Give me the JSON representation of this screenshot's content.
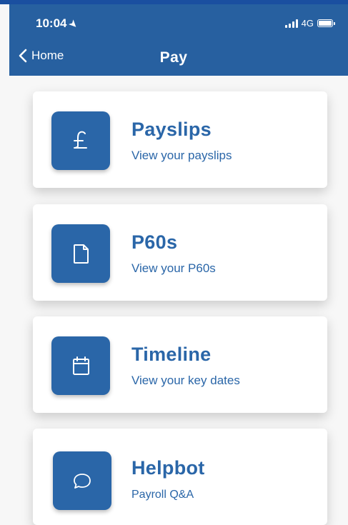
{
  "status_bar": {
    "time": "10:04",
    "network": "4G"
  },
  "nav": {
    "back_label": "Home",
    "title": "Pay"
  },
  "cards": [
    {
      "title": "Payslips",
      "subtitle": "View your payslips",
      "icon": "pound-icon"
    },
    {
      "title": "P60s",
      "subtitle": "View your P60s",
      "icon": "document-icon"
    },
    {
      "title": "Timeline",
      "subtitle": "View your key dates",
      "icon": "calendar-icon"
    },
    {
      "title": "Helpbot",
      "subtitle": "Payroll Q&A",
      "icon": "chat-bubble-icon"
    }
  ],
  "colors": {
    "header": "#2760a0",
    "accent": "#2a66a8",
    "background": "#f7f7f7"
  }
}
